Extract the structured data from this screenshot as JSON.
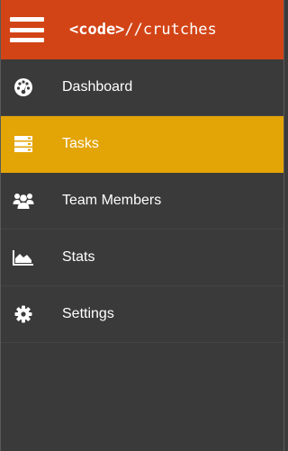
{
  "header": {
    "brand_bold": "<code>",
    "brand_rest": "//crutches",
    "bg_color": "#d24416"
  },
  "menu": {
    "items": [
      {
        "label": "Dashboard",
        "icon": "dashboard-icon",
        "active": false
      },
      {
        "label": "Tasks",
        "icon": "tasks-icon",
        "active": true
      },
      {
        "label": "Team Members",
        "icon": "users-icon",
        "active": false
      },
      {
        "label": "Stats",
        "icon": "area-chart-icon",
        "active": false
      },
      {
        "label": "Settings",
        "icon": "gear-icon",
        "active": false
      }
    ],
    "active_color": "#e3a406",
    "bg_color": "#3a3a3a"
  }
}
